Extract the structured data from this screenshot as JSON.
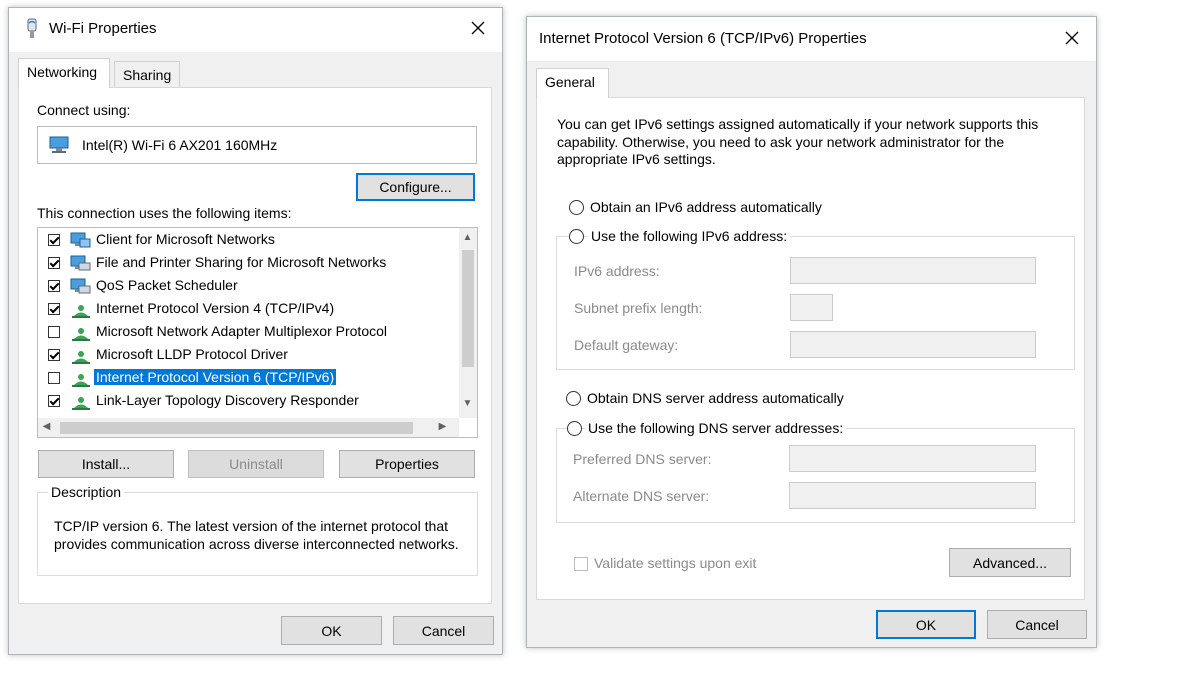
{
  "wifi": {
    "title": "Wi-Fi Properties",
    "tabs": [
      "Networking",
      "Sharing"
    ],
    "connect_using_label": "Connect using:",
    "adapter_name": "Intel(R) Wi-Fi 6 AX201 160MHz",
    "configure_label": "Configure...",
    "items_label": "This connection uses the following items:",
    "items": [
      {
        "label": "Client for Microsoft Networks",
        "checked": true,
        "icon": "network-client-icon",
        "selected": false
      },
      {
        "label": "File and Printer Sharing for Microsoft Networks",
        "checked": true,
        "icon": "network-service-icon",
        "selected": false
      },
      {
        "label": "QoS Packet Scheduler",
        "checked": true,
        "icon": "network-service-icon",
        "selected": false
      },
      {
        "label": "Internet Protocol Version 4 (TCP/IPv4)",
        "checked": true,
        "icon": "network-protocol-icon",
        "selected": false
      },
      {
        "label": "Microsoft Network Adapter Multiplexor Protocol",
        "checked": false,
        "icon": "network-protocol-icon",
        "selected": false
      },
      {
        "label": "Microsoft LLDP Protocol Driver",
        "checked": true,
        "icon": "network-protocol-icon",
        "selected": false
      },
      {
        "label": "Internet Protocol Version 6 (TCP/IPv6)",
        "checked": false,
        "icon": "network-protocol-icon",
        "selected": true
      },
      {
        "label": "Link-Layer Topology Discovery Responder",
        "checked": true,
        "icon": "network-protocol-icon",
        "selected": false
      }
    ],
    "install_label": "Install...",
    "uninstall_label": "Uninstall",
    "properties_label": "Properties",
    "description_label": "Description",
    "description_text": "TCP/IP version 6. The latest version of the internet protocol that provides communication across diverse interconnected networks.",
    "ok_label": "OK",
    "cancel_label": "Cancel"
  },
  "ipv6": {
    "title": "Internet Protocol Version 6 (TCP/IPv6) Properties",
    "tab": "General",
    "intro": "You can get IPv6 settings assigned automatically if your network supports this capability. Otherwise, you need to ask your network administrator for the appropriate IPv6 settings.",
    "obtain_ip_auto": "Obtain an IPv6 address automatically",
    "use_following_ip": "Use the following IPv6 address:",
    "ipv6_address_label": "IPv6 address:",
    "subnet_prefix_label": "Subnet prefix length:",
    "default_gateway_label": "Default gateway:",
    "obtain_dns_auto": "Obtain DNS server address automatically",
    "use_following_dns": "Use the following DNS server addresses:",
    "preferred_dns_label": "Preferred DNS server:",
    "alternate_dns_label": "Alternate DNS server:",
    "validate_label": "Validate settings upon exit",
    "advanced_label": "Advanced...",
    "ok_label": "OK",
    "cancel_label": "Cancel"
  },
  "colors": {
    "selection": "#0078d7",
    "focus_border": "#0078d7",
    "window_bg": "#f0f0f0"
  }
}
